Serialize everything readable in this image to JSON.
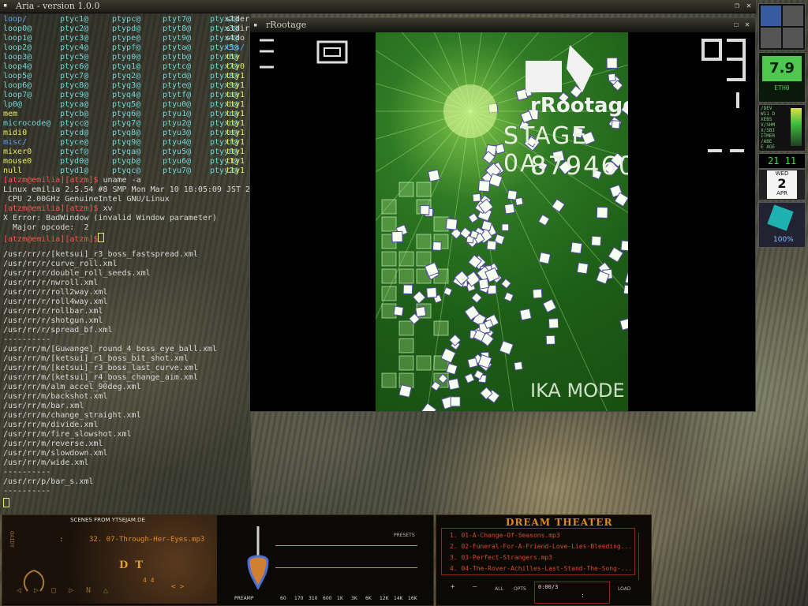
{
  "aria_window": {
    "title": "Aria - version 1.0.0",
    "buttons": {
      "restore": "❐",
      "close": "✕"
    },
    "listing_rows": [
      [
        "loop/",
        "ptyc1@",
        "ptypc@",
        "ptyt7@",
        "ptyx2@",
        "stder"
      ],
      [
        "loop0@",
        "ptyc2@",
        "ptypd@",
        "ptyt8@",
        "ptyx3@",
        "stdir"
      ],
      [
        "loop1@",
        "ptyc3@",
        "ptype@",
        "ptyt9@",
        "ptyx4@",
        "stdo"
      ],
      [
        "loop2@",
        "ptyc4@",
        "ptypf@",
        "ptyta@",
        "ptyx5@",
        "tts/"
      ],
      [
        "loop3@",
        "ptyc5@",
        "ptyq0@",
        "ptytb@",
        "ptyx6@",
        "tty"
      ],
      [
        "loop4@",
        "ptyc6@",
        "ptyq1@",
        "ptytc@",
        "ptyx7@",
        "tty0"
      ],
      [
        "loop5@",
        "ptyc7@",
        "ptyq2@",
        "ptytd@",
        "ptyx8@",
        "tty1"
      ],
      [
        "loop6@",
        "ptyc8@",
        "ptyq3@",
        "ptyte@",
        "ptyx9@",
        "tty1"
      ],
      [
        "loop7@",
        "ptyc9@",
        "ptyq4@",
        "ptytf@",
        "ptyxa@",
        "tty1"
      ],
      [
        "lp0@",
        "ptyca@",
        "ptyq5@",
        "ptyu0@",
        "ptyxb@",
        "tty1"
      ],
      [
        "mem",
        "ptycb@",
        "ptyq6@",
        "ptyu1@",
        "ptyxc@",
        "tty1"
      ],
      [
        "microcode@",
        "ptycc@",
        "ptyq7@",
        "ptyu2@",
        "ptyxd@",
        "tty1"
      ],
      [
        "midi0",
        "ptycd@",
        "ptyq8@",
        "ptyu3@",
        "ptyxe@",
        "tty1"
      ],
      [
        "misc/",
        "ptyce@",
        "ptyq9@",
        "ptyu4@",
        "ptyxf@",
        "tty1"
      ],
      [
        "mixer0",
        "ptycf@",
        "ptyqa@",
        "ptyu5@",
        "ptyy0@",
        "tty1"
      ],
      [
        "mouse0",
        "ptyd0@",
        "ptyqb@",
        "ptyu6@",
        "ptyy1@",
        "tty1"
      ],
      [
        "null",
        "ptyd1@",
        "ptyqc@",
        "ptyu7@",
        "ptyy2@",
        "tty1"
      ]
    ],
    "prompt": "[atzm@emilia][atzm]$",
    "cmd1": " uname -a",
    "uname_out1": "Linux emilia 2.5.54 #8 SMP Mon Mar 10 18:05:09 JST 2",
    "uname_out2": " CPU 2.00GHz GenuineIntel GNU/Linux",
    "cmd2": " xv",
    "xerr1": "X Error: BadWindow (invalid Window parameter)",
    "xerr2": "  Major opcode:  2",
    "paths": [
      "/usr/rr/r/[ketsui]_r3_boss_fastspread.xml",
      "/usr/rr/r/curve_roll.xml",
      "/usr/rr/r/double_roll_seeds.xml",
      "/usr/rr/r/nwroll.xml",
      "/usr/rr/r/roll2way.xml",
      "/usr/rr/r/roll4way.xml",
      "/usr/rr/r/rollbar.xml",
      "/usr/rr/r/shotgun.xml",
      "/usr/rr/r/spread_bf.xml",
      "----------",
      "/usr/rr/m/[Guwange]_round_4_boss_eye_ball.xml",
      "/usr/rr/m/[ketsui]_r1_boss_bit_shot.xml",
      "/usr/rr/m/[ketsui]_r3_boss_last_curve.xml",
      "/usr/rr/m/[ketsui]_r4_boss_change_aim.xml",
      "/usr/rr/m/alm_accel_90deg.xml",
      "/usr/rr/m/backshot.xml",
      "/usr/rr/m/bar.xml",
      "/usr/rr/m/change_straight.xml",
      "/usr/rr/m/divide.xml",
      "/usr/rr/m/fire_slowshot.xml",
      "/usr/rr/m/reverse.xml",
      "/usr/rr/m/slowdown.xml",
      "/usr/rr/m/wide.xml",
      "----------",
      "/usr/rr/p/bar_s.xml",
      "----------"
    ]
  },
  "rrootage_window": {
    "title": "rRootage",
    "logo": "rRootage",
    "stage": "STAGE 0A",
    "score": "879460",
    "mode": "IKA MODE",
    "left_hud": "2",
    "right_hud": "3"
  },
  "dockapps": {
    "cpu_temp": "7.9",
    "cpu_label": "ETH0",
    "monitor_labels": [
      "/DEV",
      "W11 D",
      "XEBS",
      "V/SHM",
      "X/SBI",
      "ITMER",
      "/ABE",
      "E AGE"
    ],
    "day_num": "21 11",
    "weekday": "WED",
    "date": "2",
    "month": "APR",
    "zoom": "100%"
  },
  "xmms": {
    "scroll_title": "SCENES FROM YTSEJAM.DE",
    "track": "32. 07-Through-Her-Eyes.mp3",
    "time": ":",
    "logo_letters": "D  T",
    "side_label": "OAIDY",
    "presets": "PRESETS",
    "preamp": "PREAMP",
    "eq_bands": [
      "60",
      "170",
      "310",
      "600",
      "1K",
      "3K",
      "6K",
      "12K",
      "14K",
      "16K"
    ],
    "controls": [
      "◁",
      "▷",
      "▢",
      "▷",
      "N",
      "△"
    ],
    "vol_hint": "4 4",
    "arrows": "< >"
  },
  "playlist": {
    "header": "DREAM THEATER",
    "items": [
      "1. 01-A-Change-Of-Seasons.mp3",
      "2. 02-Funeral-For-A-Friend-Love-Lies-Bleeding...",
      "3. 03-Perfect-Strangers.mp3",
      "4. 04-The-Rover-Achilles-Last-Stand-The-Song-..."
    ],
    "buttons": [
      "+",
      "—",
      "ALL",
      "OPTS",
      "LOAD"
    ],
    "time_display": "0:00/3",
    "colon": ":"
  },
  "colors": {
    "term_blue": "#5aa0ff",
    "term_cyan": "#6fd6d6",
    "term_yellow": "#e8e860",
    "term_red": "#ff5050",
    "game_green": "#2f7a24",
    "xmms_orange": "#e08a20",
    "playlist_red": "#d84b2a"
  }
}
